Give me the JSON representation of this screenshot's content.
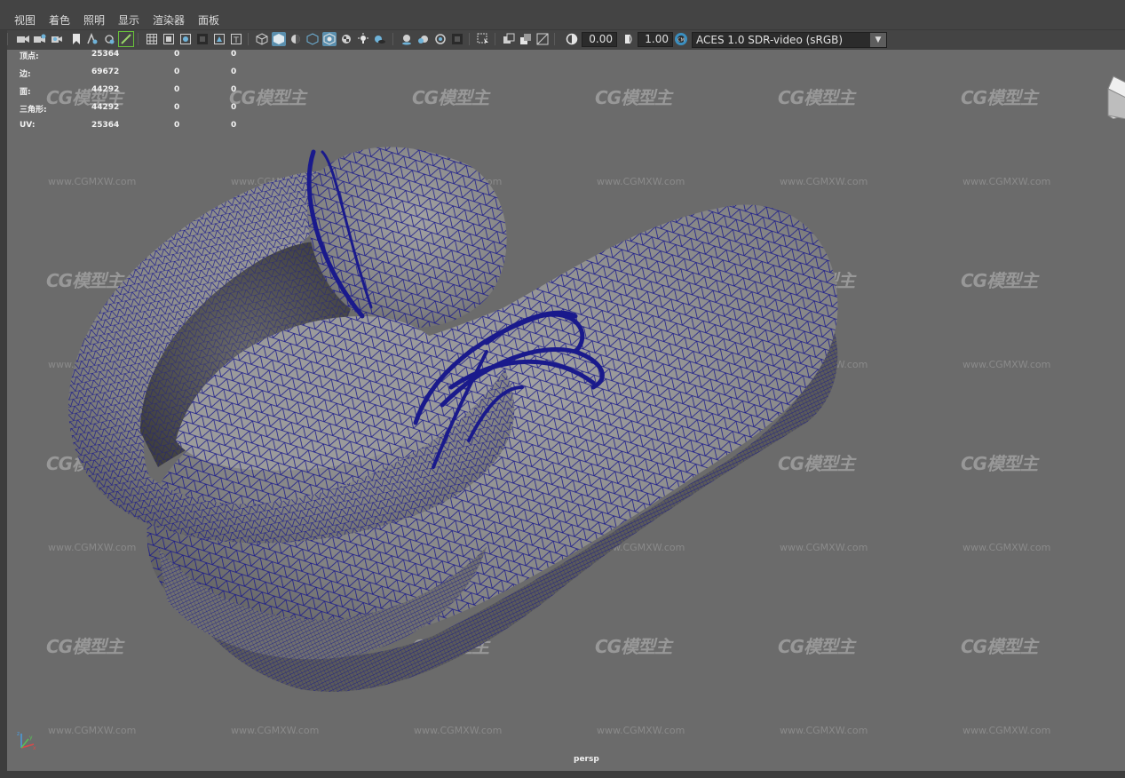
{
  "menu": {
    "items": [
      {
        "label": "视图"
      },
      {
        "label": "着色"
      },
      {
        "label": "照明"
      },
      {
        "label": "显示"
      },
      {
        "label": "渲染器"
      },
      {
        "label": "面板"
      }
    ]
  },
  "toolbar": {
    "exposure_value": "0.00",
    "gamma_value": "1.00",
    "color_space": "ACES 1.0 SDR-video (sRGB)"
  },
  "hud": {
    "rows": [
      {
        "label": "顶点:",
        "total": "25364",
        "selected": "0",
        "other": "0"
      },
      {
        "label": "边:",
        "total": "69672",
        "selected": "0",
        "other": "0"
      },
      {
        "label": "面:",
        "total": "44292",
        "selected": "0",
        "other": "0"
      },
      {
        "label": "三角形:",
        "total": "44292",
        "selected": "0",
        "other": "0"
      },
      {
        "label": "UV:",
        "total": "25364",
        "selected": "0",
        "other": "0"
      }
    ]
  },
  "viewport": {
    "camera_label": "persp",
    "wireframe_color": "#1a1a8c",
    "mesh_color": "#8a8a8a",
    "background_color": "#6b6b6b"
  },
  "watermark": {
    "logo_text": "CG模型主",
    "url_text": "www.CGMXW.com"
  },
  "icons": [
    "camera-icon",
    "camera-attr-icon",
    "bookmark-icon",
    "select-camera-icon",
    "grid-icon",
    "film-gate-icon",
    "resolution-gate-icon",
    "field-chart-icon",
    "safe-action-icon",
    "safe-title-icon",
    "wireframe-icon",
    "smooth-shade-icon",
    "flat-shade-icon",
    "bounding-box-icon",
    "textured-icon",
    "lights-icon",
    "shadows-icon",
    "ao-icon",
    "motion-blur-icon",
    "aa-icon",
    "isolate-icon",
    "xray-icon",
    "xray-joints-icon",
    "backface-icon",
    "exposure-icon",
    "gamma-icon",
    "color-mgmt-icon"
  ]
}
